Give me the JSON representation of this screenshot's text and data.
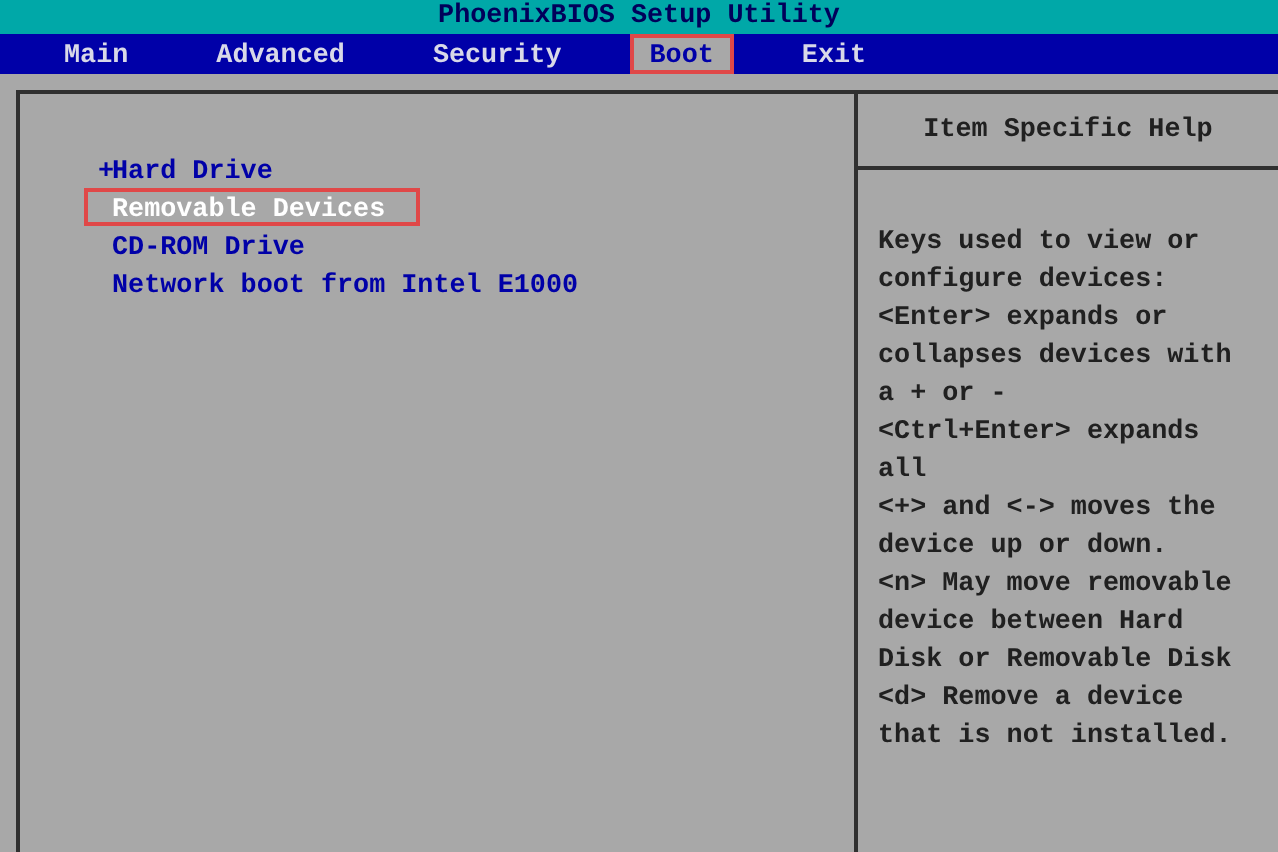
{
  "window": {
    "title": "PhoenixBIOS Setup Utility"
  },
  "tabs": [
    {
      "label": "Main",
      "selected": false,
      "annotated": false
    },
    {
      "label": "Advanced",
      "selected": false,
      "annotated": false
    },
    {
      "label": "Security",
      "selected": false,
      "annotated": false
    },
    {
      "label": "Boot",
      "selected": true,
      "annotated": true
    },
    {
      "label": "Exit",
      "selected": false,
      "annotated": false
    }
  ],
  "boot_items": [
    {
      "label": "Hard Drive",
      "expander": "+",
      "selected": false,
      "annotated": false
    },
    {
      "label": "Removable Devices",
      "selected": true,
      "annotated": true
    },
    {
      "label": "CD-ROM Drive",
      "selected": false,
      "annotated": false
    },
    {
      "label": "Network boot from Intel E1000",
      "selected": false,
      "annotated": false
    }
  ],
  "help": {
    "title": "Item Specific Help",
    "lines": [
      "Keys used to view or",
      "configure devices:",
      "<Enter> expands or",
      "collapses devices with",
      "a + or -",
      "<Ctrl+Enter> expands",
      "all",
      "<+> and <-> moves the",
      "device up or down.",
      "<n> May move removable",
      "device between Hard",
      "Disk or Removable Disk",
      "<d> Remove a device",
      "that is not installed."
    ]
  }
}
